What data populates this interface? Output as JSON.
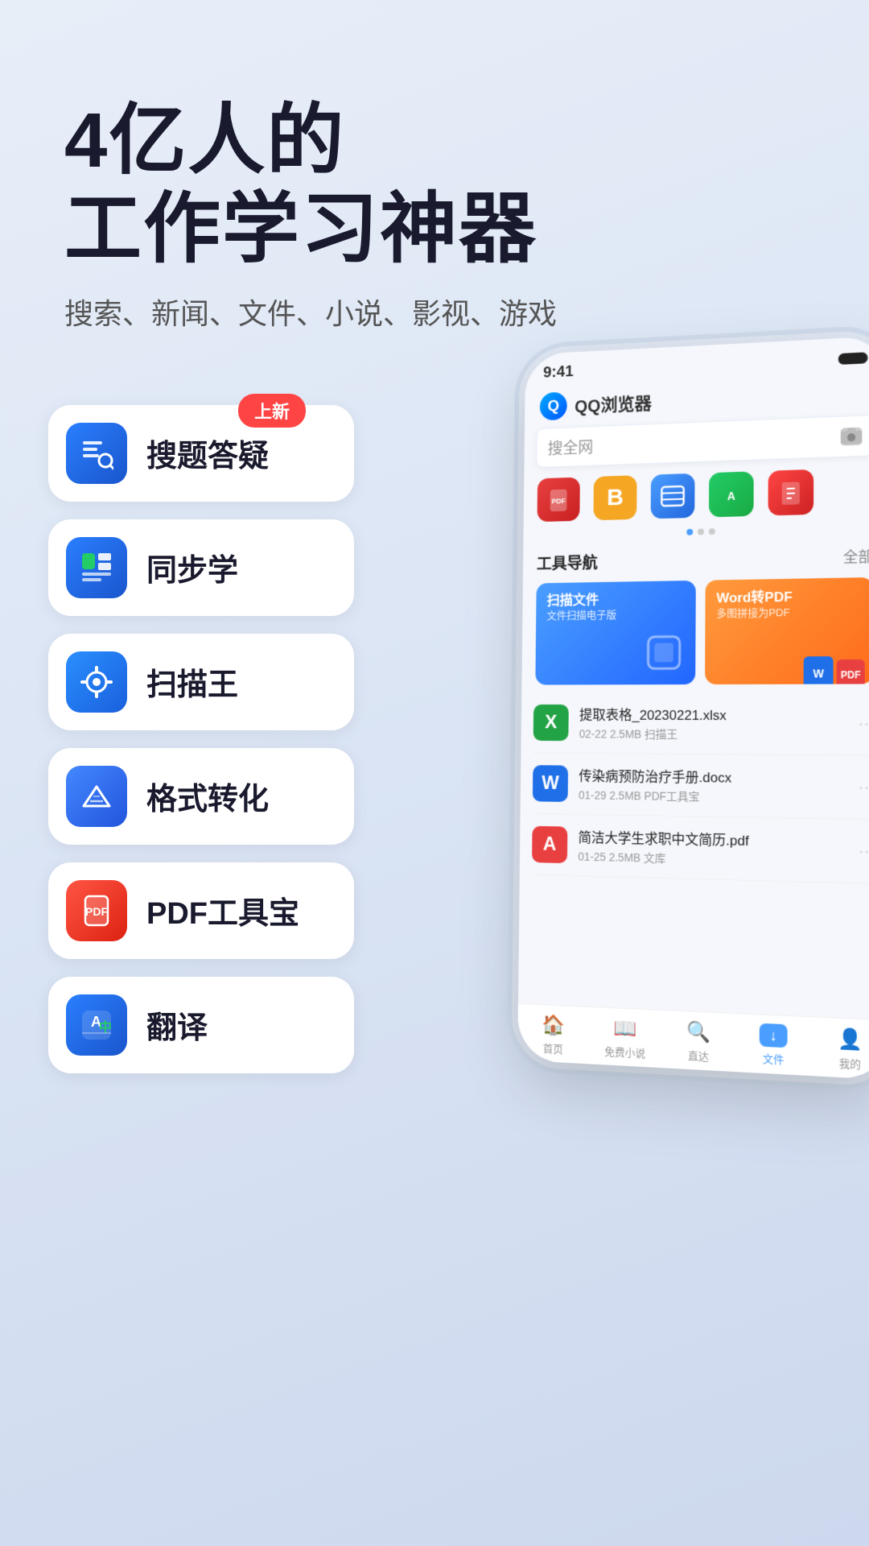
{
  "hero": {
    "title_line1": "4亿人的",
    "title_line2": "工作学习神器",
    "subtitle": "搜索、新闻、文件、小说、影视、游戏"
  },
  "features": [
    {
      "id": "search-qa",
      "label": "搜题答疑",
      "icon_color": "#1a6ff5",
      "has_badge": true,
      "badge_label": "上新"
    },
    {
      "id": "sync-study",
      "label": "同步学",
      "icon_color": "#1a6ff5",
      "has_badge": false,
      "badge_label": ""
    },
    {
      "id": "scan-king",
      "label": "扫描王",
      "icon_color": "#1a6ff5",
      "has_badge": false,
      "badge_label": ""
    },
    {
      "id": "format-convert",
      "label": "格式转化",
      "icon_color": "#1a6ff5",
      "has_badge": false,
      "badge_label": ""
    },
    {
      "id": "pdf-tool",
      "label": "PDF工具宝",
      "icon_color": "#e84040",
      "has_badge": false,
      "badge_label": ""
    },
    {
      "id": "translate",
      "label": "翻译",
      "icon_color": "#1a6ff5",
      "has_badge": false,
      "badge_label": ""
    }
  ],
  "phone": {
    "status_time": "9:41",
    "browser_title": "QQ浏览器",
    "search_placeholder": "搜全网",
    "tool_nav_title": "工具导航",
    "tool_nav_all": "全部",
    "tool_card_scan_title": "扫描文件",
    "tool_card_scan_sub": "文件扫描电子版",
    "tool_card_word_title": "Word转PDF",
    "tool_card_word_sub": "多图拼接为PDF",
    "files": [
      {
        "name": "提取表格_20230221.xlsx",
        "meta": "02-22  2.5MB  扫描王",
        "type": "xlsx"
      },
      {
        "name": "传染病预防治疗手册.docx",
        "meta": "01-29  2.5MB  PDF工具宝",
        "type": "docx"
      },
      {
        "name": "简洁大学生求职中文简历.pdf",
        "meta": "01-25  2.5MB  文库",
        "type": "pdf"
      }
    ],
    "bottom_nav": [
      {
        "label": "首页",
        "icon": "🏠",
        "active": false
      },
      {
        "label": "免费小说",
        "icon": "📖",
        "active": false
      },
      {
        "label": "直达",
        "icon": "🔍",
        "active": false
      },
      {
        "label": "文件",
        "icon": "📥",
        "active": true
      },
      {
        "label": "我的",
        "icon": "👤",
        "active": false
      }
    ]
  }
}
